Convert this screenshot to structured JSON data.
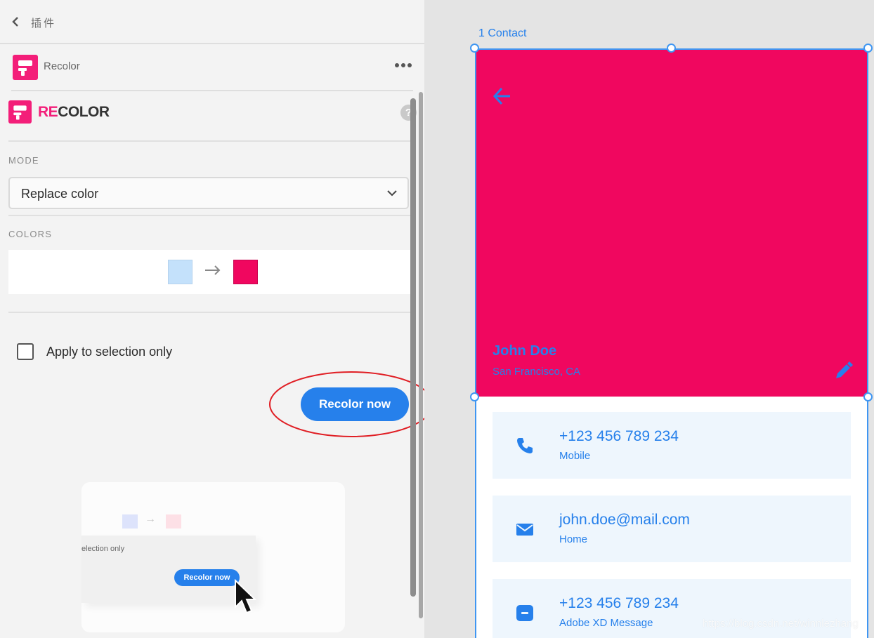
{
  "topbar": {
    "title": "插件"
  },
  "plugin": {
    "name": "Recolor"
  },
  "brand": {
    "part1": "RE",
    "part2": "COLOR"
  },
  "mode": {
    "label": "MODE",
    "value": "Replace color"
  },
  "colors": {
    "label": "COLORS",
    "from": "#c4e1fb",
    "to": "#f0075f",
    "arrow": "→"
  },
  "option": {
    "label": "Apply to selection only",
    "checked": false
  },
  "action": {
    "label": "Recolor now"
  },
  "preview": {
    "label": "election only",
    "button": "Recolor now",
    "arrow": "→"
  },
  "artboard": {
    "title": "1 Contact",
    "name": "John Doe",
    "location": "San Francisco, CA",
    "items": [
      {
        "main": "+123 456 789 234",
        "sub": "Mobile",
        "icon": "phone-icon"
      },
      {
        "main": "john.doe@mail.com",
        "sub": "Home",
        "icon": "mail-icon"
      },
      {
        "main": "+123 456 789 234",
        "sub": "Adobe XD Message",
        "icon": "message-icon"
      }
    ]
  },
  "watermark": "https://blog.csdn.net/winnlezhang",
  "accent": "#2680eb",
  "brand_pink": "#f31e79"
}
